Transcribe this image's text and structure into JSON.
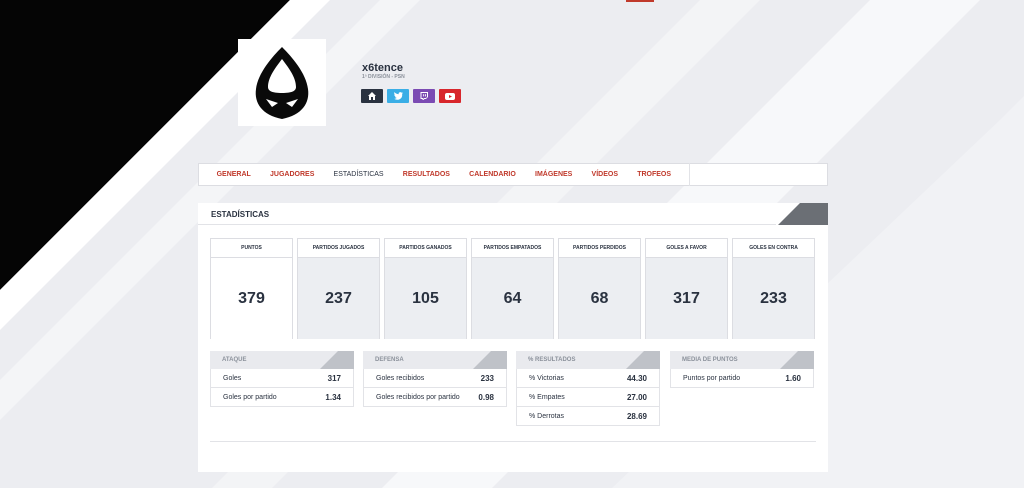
{
  "team": {
    "name": "x6tence",
    "division": "1ª DIVISIÓN - PSN"
  },
  "socials": [
    {
      "icon": "home-icon",
      "color": "#2a3240"
    },
    {
      "icon": "twitter-icon",
      "color": "#3aaee6"
    },
    {
      "icon": "twitch-icon",
      "color": "#7b4bb3"
    },
    {
      "icon": "youtube-icon",
      "color": "#d8262c"
    }
  ],
  "tabs": [
    "GENERAL",
    "JUGADORES",
    "ESTADÍSTICAS",
    "RESULTADOS",
    "CALENDARIO",
    "IMÁGENES",
    "VÍDEOS",
    "TROFEOS"
  ],
  "active_tab": "ESTADÍSTICAS",
  "panel_title": "ESTADÍSTICAS",
  "stats": [
    {
      "label": "PUNTOS",
      "value": "379"
    },
    {
      "label": "PARTIDOS JUGADOS",
      "value": "237"
    },
    {
      "label": "PARTIDOS GANADOS",
      "value": "105"
    },
    {
      "label": "PARTIDOS EMPATADOS",
      "value": "64"
    },
    {
      "label": "PARTIDOS PERDIDOS",
      "value": "68"
    },
    {
      "label": "GOLES A FAVOR",
      "value": "317"
    },
    {
      "label": "GOLES EN CONTRA",
      "value": "233"
    }
  ],
  "boxes": [
    {
      "title": "ATAQUE",
      "rows": [
        {
          "label": "Goles",
          "value": "317"
        },
        {
          "label": "Goles por partido",
          "value": "1.34"
        }
      ]
    },
    {
      "title": "DEFENSA",
      "rows": [
        {
          "label": "Goles recibidos",
          "value": "233"
        },
        {
          "label": "Goles recibidos por partido",
          "value": "0.98"
        }
      ]
    },
    {
      "title": "% RESULTADOS",
      "rows": [
        {
          "label": "% Victorias",
          "value": "44.30"
        },
        {
          "label": "% Empates",
          "value": "27.00"
        },
        {
          "label": "% Derrotas",
          "value": "28.69"
        }
      ]
    },
    {
      "title": "MEDIA DE PUNTOS",
      "rows": [
        {
          "label": "Puntos por partido",
          "value": "1.60"
        }
      ]
    }
  ],
  "colors": {
    "accent": "#c0392b",
    "dark": "#2a3240"
  }
}
